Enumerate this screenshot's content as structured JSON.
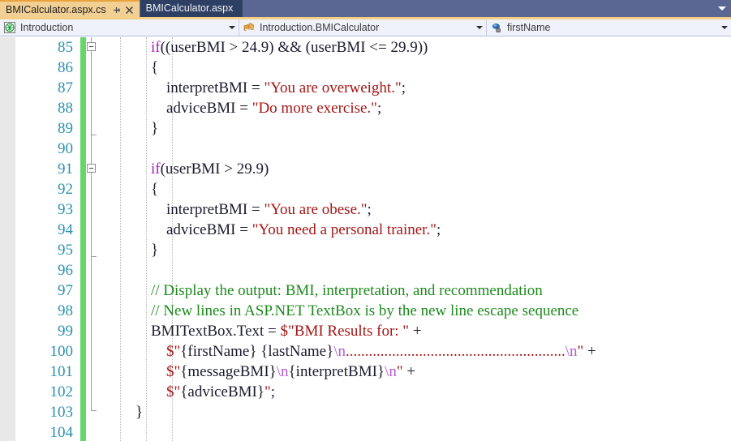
{
  "window": {
    "tabs": [
      {
        "label": "BMICalculator.aspx.cs",
        "active": true,
        "pin_icon": "pin-icon",
        "close_icon": "close-icon"
      },
      {
        "label": "BMICalculator.aspx",
        "active": false
      }
    ],
    "tabstrip_overflow_icon": "chevron-down-icon"
  },
  "navbar": {
    "project": {
      "icon": "web-globe-icon",
      "label": "Introduction",
      "arrow": "chevron-down-icon"
    },
    "type": {
      "icon": "class-puzzle-icon",
      "label": "Introduction.BMICalculator",
      "arrow": "chevron-down-icon"
    },
    "member": {
      "icon": "private-field-icon",
      "label": "firstName",
      "arrow": "chevron-down-icon"
    }
  },
  "editor": {
    "first_line_number": 85,
    "change_bar_color": "#66d66b",
    "line_number_color": "#2b91af",
    "colors": {
      "keyword": "#a020b0",
      "string": "#a31515",
      "comment": "#1d8a1d",
      "escape": "#b35bd6",
      "plain": "#1b1b2f"
    },
    "lines": [
      {
        "n": 85,
        "fold": "collapse",
        "tokens": [
          {
            "t": "        ",
            "c": "plain"
          },
          {
            "t": "if",
            "c": "kw"
          },
          {
            "t": "((userBMI > 24.9) && (userBMI <= 29.9))",
            "c": "plain"
          }
        ]
      },
      {
        "n": 86,
        "tokens": [
          {
            "t": "        {",
            "c": "plain"
          }
        ]
      },
      {
        "n": 87,
        "tokens": [
          {
            "t": "            interpretBMI = ",
            "c": "plain"
          },
          {
            "t": "\"You are overweight.\"",
            "c": "str"
          },
          {
            "t": ";",
            "c": "plain"
          }
        ]
      },
      {
        "n": 88,
        "tokens": [
          {
            "t": "            adviceBMI = ",
            "c": "plain"
          },
          {
            "t": "\"Do more exercise.\"",
            "c": "str"
          },
          {
            "t": ";",
            "c": "plain"
          }
        ]
      },
      {
        "n": 89,
        "tokens": [
          {
            "t": "        }",
            "c": "plain"
          }
        ]
      },
      {
        "n": 90,
        "tokens": []
      },
      {
        "n": 91,
        "fold": "collapse",
        "tokens": [
          {
            "t": "        ",
            "c": "plain"
          },
          {
            "t": "if",
            "c": "kw"
          },
          {
            "t": "(userBMI > 29.9)",
            "c": "plain"
          }
        ]
      },
      {
        "n": 92,
        "tokens": [
          {
            "t": "        {",
            "c": "plain"
          }
        ]
      },
      {
        "n": 93,
        "tokens": [
          {
            "t": "            interpretBMI = ",
            "c": "plain"
          },
          {
            "t": "\"You are obese.\"",
            "c": "str"
          },
          {
            "t": ";",
            "c": "plain"
          }
        ]
      },
      {
        "n": 94,
        "tokens": [
          {
            "t": "            adviceBMI = ",
            "c": "plain"
          },
          {
            "t": "\"You need a personal trainer.\"",
            "c": "str"
          },
          {
            "t": ";",
            "c": "plain"
          }
        ]
      },
      {
        "n": 95,
        "tokens": [
          {
            "t": "        }",
            "c": "plain"
          }
        ]
      },
      {
        "n": 96,
        "tokens": []
      },
      {
        "n": 97,
        "tokens": [
          {
            "t": "        // Display the output: BMI, interpretation, and recommendation",
            "c": "cmt"
          }
        ]
      },
      {
        "n": 98,
        "tokens": [
          {
            "t": "        // New lines in ASP.NET TextBox is by the new line escape sequence",
            "c": "cmt"
          }
        ]
      },
      {
        "n": 99,
        "tokens": [
          {
            "t": "        BMITextBox.Text = ",
            "c": "plain"
          },
          {
            "t": "$\"BMI Results for: \"",
            "c": "str"
          },
          {
            "t": " +",
            "c": "plain"
          }
        ]
      },
      {
        "n": 100,
        "tokens": [
          {
            "t": "            ",
            "c": "plain"
          },
          {
            "t": "$\"",
            "c": "str"
          },
          {
            "t": "{firstName} {lastName}",
            "c": "plain"
          },
          {
            "t": "\\n",
            "c": "esc"
          },
          {
            "t": ".........................................................",
            "c": "str"
          },
          {
            "t": "\\n",
            "c": "esc"
          },
          {
            "t": "\"",
            "c": "str"
          },
          {
            "t": " +",
            "c": "plain"
          }
        ]
      },
      {
        "n": 101,
        "tokens": [
          {
            "t": "            ",
            "c": "plain"
          },
          {
            "t": "$\"",
            "c": "str"
          },
          {
            "t": "{messageBMI}",
            "c": "plain"
          },
          {
            "t": "\\n",
            "c": "esc"
          },
          {
            "t": "{interpretBMI}",
            "c": "plain"
          },
          {
            "t": "\\n",
            "c": "esc"
          },
          {
            "t": "\"",
            "c": "str"
          },
          {
            "t": " +",
            "c": "plain"
          }
        ]
      },
      {
        "n": 102,
        "tokens": [
          {
            "t": "            ",
            "c": "plain"
          },
          {
            "t": "$\"",
            "c": "str"
          },
          {
            "t": "{adviceBMI}",
            "c": "plain"
          },
          {
            "t": "\"",
            "c": "str"
          },
          {
            "t": ";",
            "c": "plain"
          }
        ]
      },
      {
        "n": 103,
        "tokens": [
          {
            "t": "    }",
            "c": "plain"
          }
        ]
      },
      {
        "n": 104,
        "tokens": []
      }
    ]
  }
}
